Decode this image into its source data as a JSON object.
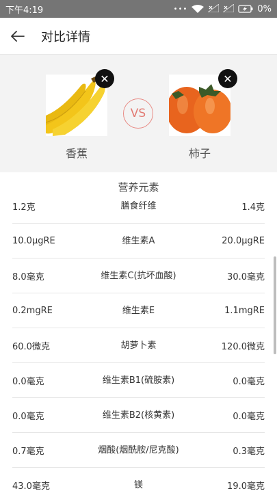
{
  "status": {
    "time": "下午4:19",
    "dots": "•••",
    "battery": "0%"
  },
  "header": {
    "title": "对比详情"
  },
  "compare": {
    "left": {
      "name": "香蕉",
      "image_icon": "banana-image"
    },
    "right": {
      "name": "柿子",
      "image_icon": "persimmon-image"
    },
    "vs": "VS",
    "remove": "✕"
  },
  "section": {
    "title": "营养元素"
  },
  "rows": [
    {
      "left": "1.2克",
      "name": "膳食纤维",
      "right": "1.4克"
    },
    {
      "left": "10.0μgRE",
      "name": "维生素A",
      "right": "20.0μgRE"
    },
    {
      "left": "8.0毫克",
      "name": "维生素C(抗坏血酸)",
      "right": "30.0毫克"
    },
    {
      "left": "0.2mgRE",
      "name": "维生素E",
      "right": "1.1mgRE"
    },
    {
      "left": "60.0微克",
      "name": "胡萝卜素",
      "right": "120.0微克"
    },
    {
      "left": "0.0毫克",
      "name": "维生素B1(硫胺素)",
      "right": "0.0毫克"
    },
    {
      "left": "0.0毫克",
      "name": "维生素B2(核黄素)",
      "right": "0.0毫克"
    },
    {
      "left": "0.7毫克",
      "name": "烟酸(烟酰胺/尼克酸)",
      "right": "0.3毫克"
    },
    {
      "left": "43.0毫克",
      "name": "镁",
      "right": "19.0毫克"
    }
  ]
}
